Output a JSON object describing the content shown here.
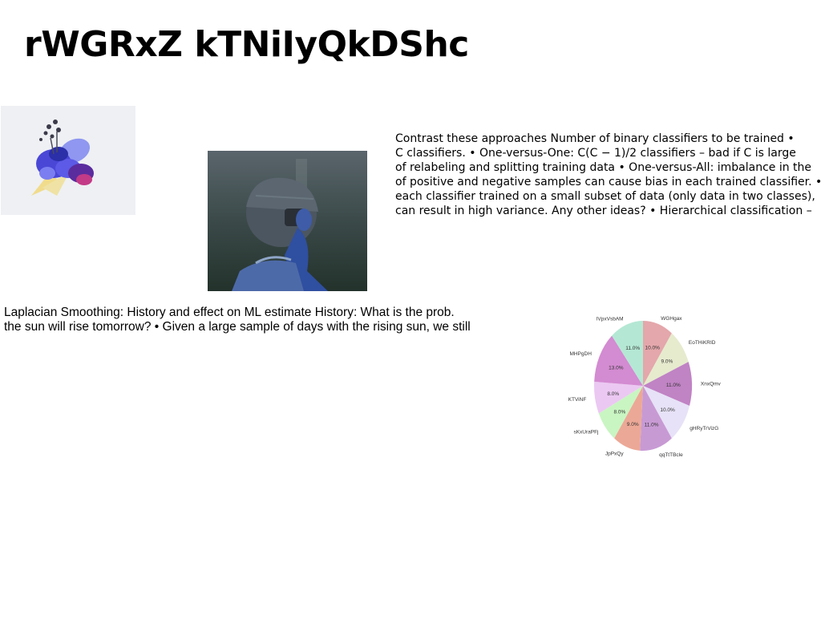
{
  "title": "rWGRxZ kTNiIyQkDShc",
  "images": {
    "flower": "flower-image",
    "photo": "photographer-image"
  },
  "para_right": [
    "Contrast these approaches Number of binary classifiers to be trained •",
    "C classifiers. • One-versus-One: C(C − 1)/2 classifiers – bad if C is large",
    "of relabeling and splitting training data • One-versus-All: imbalance in the",
    "of positive and negative samples can cause bias in each trained classifier. •",
    "each classifier trained on a small subset of data (only data in two classes),",
    "can result in high variance. Any other ideas? • Hierarchical classification –"
  ],
  "para_left": [
    "Laplacian Smoothing: History and effect on ML estimate History: What is the prob.",
    "the sun will rise tomorrow? • Given a large sample of days with the rising sun, we still"
  ],
  "chart_data": {
    "type": "pie",
    "title": "",
    "slices": [
      {
        "label": "WGHgax",
        "value": 10.0,
        "pct": "10.0%",
        "color": "#e4a7ab"
      },
      {
        "label": "EoTHiKRID",
        "value": 9.0,
        "pct": "9.0%",
        "color": "#e6ebce"
      },
      {
        "label": "XnxQmv",
        "value": 11.0,
        "pct": "11.0%",
        "color": "#c083c4"
      },
      {
        "label": "gHRyTrVizG",
        "value": 10.0,
        "pct": "10.0%",
        "color": "#e7e2f7"
      },
      {
        "label": "qqTtTBcle",
        "value": 11.0,
        "pct": "11.0%",
        "color": "#c89ad4"
      },
      {
        "label": "JpPxQy",
        "value": 9.0,
        "pct": "9.0%",
        "color": "#eca896"
      },
      {
        "label": "sKxUraPFj",
        "value": 8.0,
        "pct": "8.0%",
        "color": "#c9f5c2"
      },
      {
        "label": "KTViNF",
        "value": 8.0,
        "pct": "8.0%",
        "color": "#ebc8f2"
      },
      {
        "label": "MHPgDH",
        "value": 13.0,
        "pct": "13.0%",
        "color": "#d38bd1"
      },
      {
        "label": "lVpxVsbAM",
        "value": 11.0,
        "pct": "11.0%",
        "color": "#b4e8d4"
      }
    ]
  }
}
